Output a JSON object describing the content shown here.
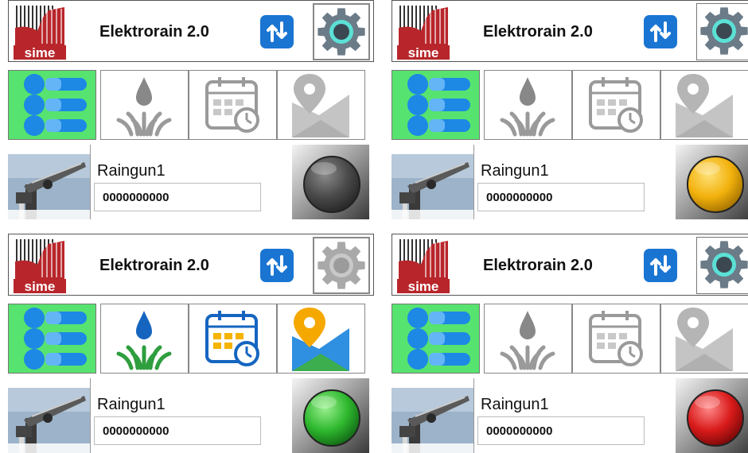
{
  "colors": {
    "sync_blue": "#1a75d2",
    "active_tab_green": "#57e36f",
    "status_off": "#555555",
    "status_yellow": "#f2b10c",
    "status_green": "#2eb82e",
    "status_red": "#d91a1a"
  },
  "panels": [
    {
      "app_title": "Elektrorain 2.0",
      "logo_text": "sime",
      "sync_icon": "sort-arrows-icon",
      "settings_icon": "gear-icon",
      "tabs": [
        {
          "icon": "list-icon",
          "active": true,
          "colored": true
        },
        {
          "icon": "irrigation-drop-icon",
          "active": false,
          "colored": false
        },
        {
          "icon": "calendar-timer-icon",
          "active": false,
          "colored": false
        },
        {
          "icon": "map-pin-icon",
          "active": false,
          "colored": false
        }
      ],
      "device": {
        "name": "Raingun1",
        "id": "0000000000",
        "status": "off"
      }
    },
    {
      "app_title": "Elektrorain 2.0",
      "logo_text": "sime",
      "sync_icon": "sort-arrows-icon",
      "settings_icon": "gear-icon",
      "tabs": [
        {
          "icon": "list-icon",
          "active": true,
          "colored": true
        },
        {
          "icon": "irrigation-drop-icon",
          "active": false,
          "colored": false
        },
        {
          "icon": "calendar-timer-icon",
          "active": false,
          "colored": false
        },
        {
          "icon": "map-pin-icon",
          "active": false,
          "colored": false
        }
      ],
      "device": {
        "name": "Raingun1",
        "id": "0000000000",
        "status": "yellow"
      }
    },
    {
      "app_title": "Elektrorain 2.0",
      "logo_text": "sime",
      "sync_icon": "sort-arrows-icon",
      "settings_icon": "gear-icon",
      "tabs": [
        {
          "icon": "list-icon",
          "active": true,
          "colored": true
        },
        {
          "icon": "irrigation-drop-icon",
          "active": false,
          "colored": true
        },
        {
          "icon": "calendar-timer-icon",
          "active": false,
          "colored": true
        },
        {
          "icon": "map-pin-icon",
          "active": false,
          "colored": true
        }
      ],
      "device": {
        "name": "Raingun1",
        "id": "0000000000",
        "status": "green"
      }
    },
    {
      "app_title": "Elektrorain 2.0",
      "logo_text": "sime",
      "sync_icon": "sort-arrows-icon",
      "settings_icon": "gear-icon",
      "tabs": [
        {
          "icon": "list-icon",
          "active": true,
          "colored": true
        },
        {
          "icon": "irrigation-drop-icon",
          "active": false,
          "colored": false
        },
        {
          "icon": "calendar-timer-icon",
          "active": false,
          "colored": false
        },
        {
          "icon": "map-pin-icon",
          "active": false,
          "colored": false
        }
      ],
      "device": {
        "name": "Raingun1",
        "id": "0000000000",
        "status": "red"
      }
    }
  ]
}
